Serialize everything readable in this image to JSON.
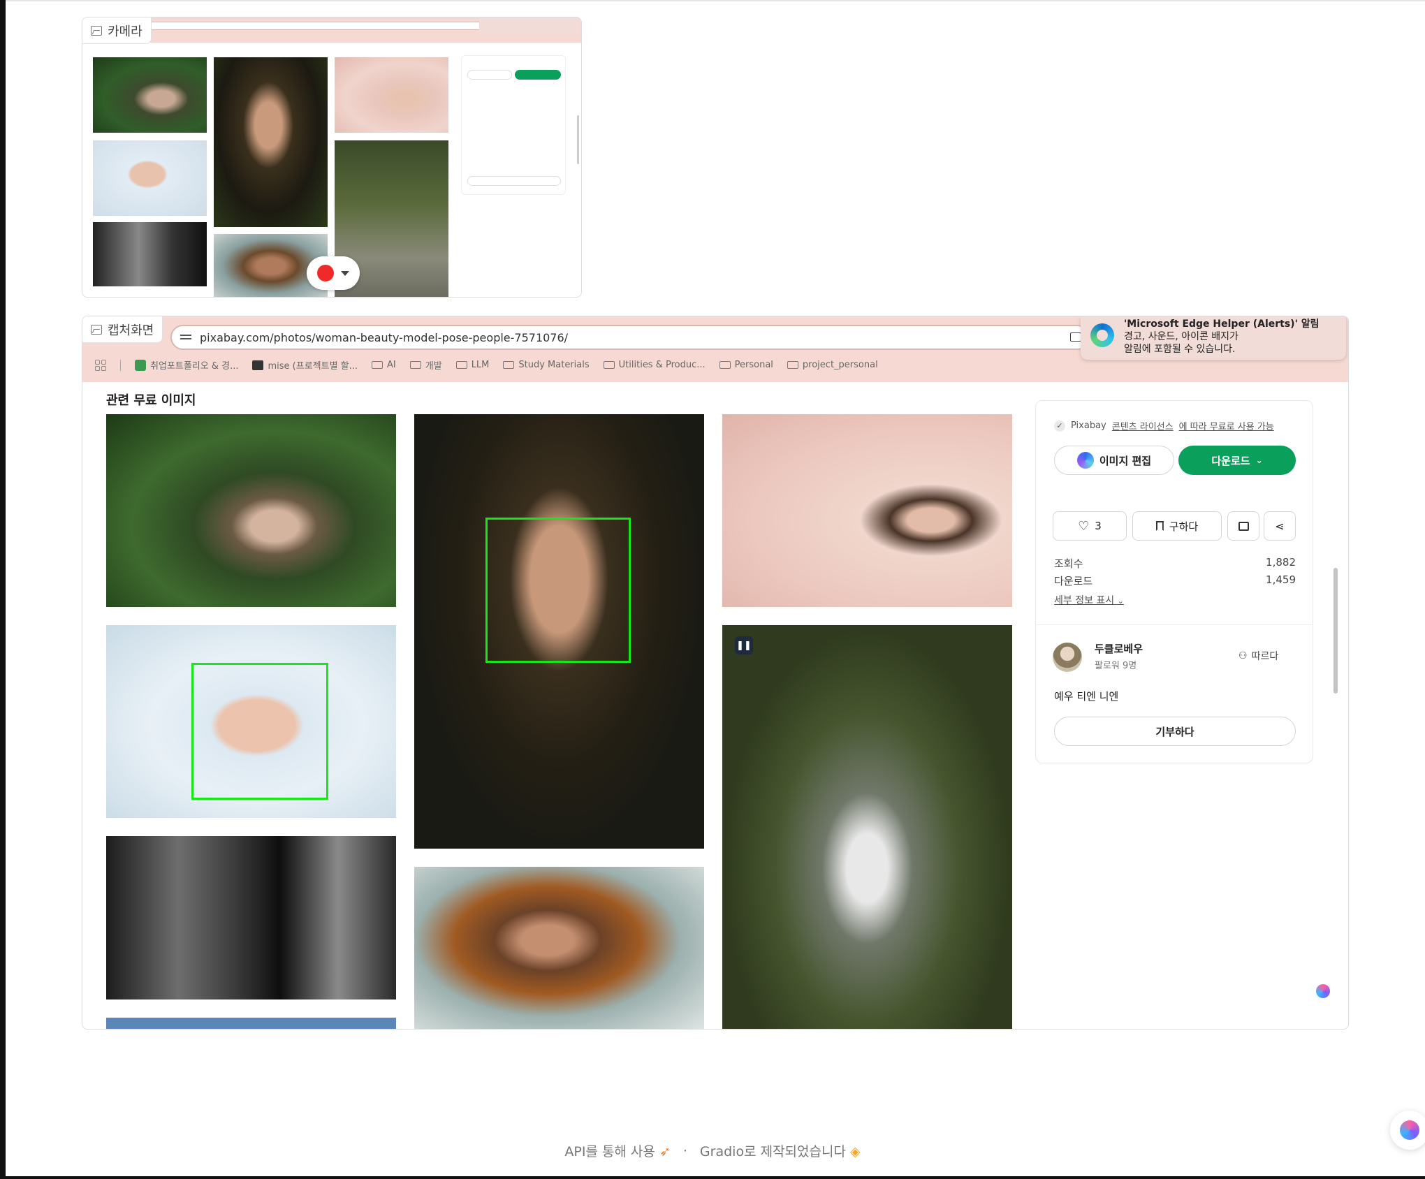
{
  "panels": {
    "camera_label": "카메라",
    "capture_label": "캡처화면"
  },
  "browser": {
    "url": "pixabay.com/photos/woman-beauty-model-pose-people-7571076/",
    "bookmarks": [
      "취업포트폴리오 & 경...",
      "mise (프로젝트별 할...",
      "AI",
      "개발",
      "LLM",
      "Study Materials",
      "Utilities & Produc...",
      "Personal",
      "project_personal"
    ],
    "notification": {
      "title": "'Microsoft Edge Helper (Alerts)' 알림",
      "line1": "경고, 사운드, 아이콘 배지가",
      "line2": "알림에 포함될 수 있습니다."
    }
  },
  "page": {
    "section_title": "관련 무료 이미지",
    "license_prefix": "Pixabay",
    "license_link": "콘텐츠 라이선스",
    "license_suffix": "에 따라 무료로 사용 가능",
    "edit_button": "이미지 편집",
    "download_button": "다운로드",
    "like_count": "3",
    "save_button": "구하다",
    "views_label": "조회수",
    "views_value": "1,882",
    "downloads_label": "다운로드",
    "downloads_value": "1,459",
    "details_link": "세부 정보 표시",
    "user_name": "두클로베우",
    "followers": "팔로워 9명",
    "follow_button": "따르다",
    "bio": "예우 티엔 니엔",
    "donate_button": "기부하다"
  },
  "footer": {
    "api_text": "API를 통해 사용",
    "separator": "·",
    "gradio_text": "Gradio로 제작되었습니다"
  },
  "colors": {
    "chrome": "#f5d9d2",
    "download_green": "#0aa05b",
    "face_box": "#19e619",
    "record_red": "#f02a2a"
  },
  "icons": [
    "image-icon",
    "tune-icon",
    "cast-icon",
    "folder-icon",
    "apps-icon",
    "edge-icon",
    "download-icon",
    "check-icon",
    "copilot-icon",
    "heart-icon",
    "bookmark-icon",
    "comment-icon",
    "share-icon",
    "follow-icon",
    "record-icon",
    "brain-icon",
    "rocket-icon",
    "gradio-icon"
  ]
}
